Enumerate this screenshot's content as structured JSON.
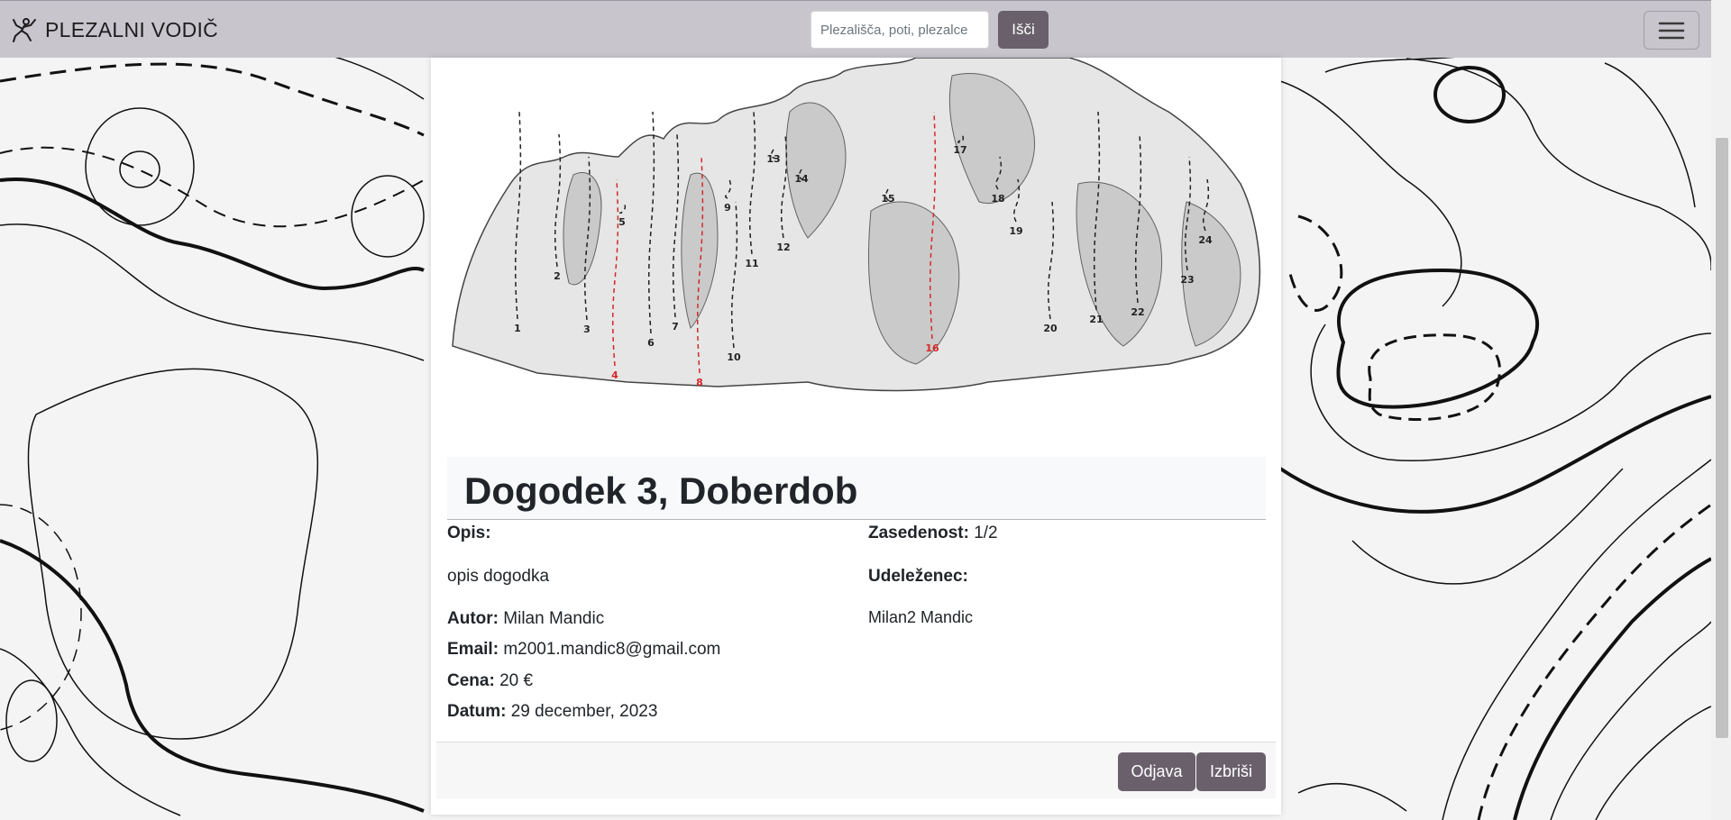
{
  "navbar": {
    "brand": "PLEZALNI VODIČ",
    "search_placeholder": "Plezališča, poti, plezalce",
    "search_button": "Išči"
  },
  "event": {
    "title": "Dogodek 3, Doberdob",
    "description_label": "Opis:",
    "description": "opis dogodka",
    "author_label": "Autor:",
    "author": "Milan Mandic",
    "email_label": "Email:",
    "email": "m2001.mandic8@gmail.com",
    "price_label": "Cena:",
    "price": "20 €",
    "date_label": "Datum:",
    "date": "29 december, 2023",
    "occupancy_label": "Zasedenost:",
    "occupancy": "1/2",
    "participant_label": "Udeleženec:",
    "participants": [
      "Milan2 Mandic"
    ]
  },
  "topo": {
    "route_numbers": [
      "1",
      "2",
      "3",
      "4",
      "5",
      "6",
      "7",
      "8",
      "9",
      "10",
      "11",
      "12",
      "13",
      "14",
      "15",
      "16",
      "17",
      "18",
      "19",
      "20",
      "21",
      "22",
      "23",
      "24"
    ],
    "highlighted_routes": [
      "4",
      "8",
      "16"
    ]
  },
  "actions": {
    "signout_button": "Odjava",
    "delete_button": "Izbriši"
  },
  "colors": {
    "navbar": "#c8c6cc",
    "button": "#6a606c",
    "highlight_route": "#d62828"
  }
}
